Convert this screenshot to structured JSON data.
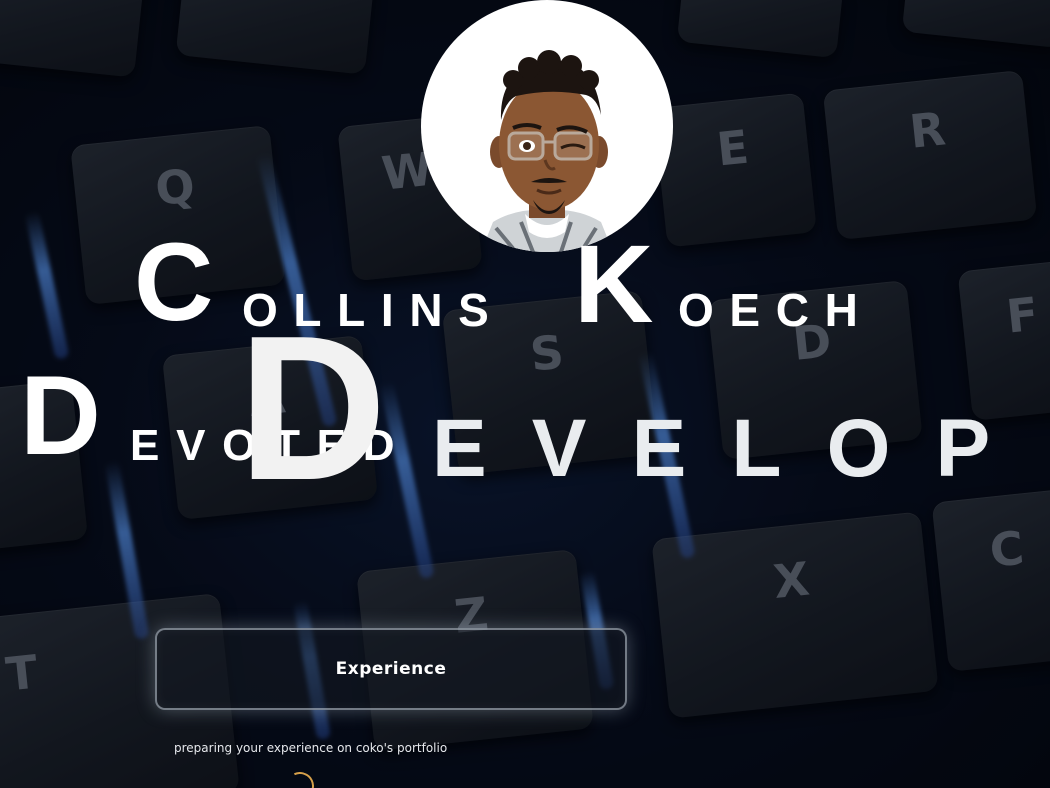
{
  "hero": {
    "first_name": {
      "initial": "C",
      "rest": "OLLINS"
    },
    "last_name": {
      "initial": "K",
      "rest": "OECH"
    },
    "tagline": {
      "word1_initial": "D",
      "word1_rest": "EVOTED",
      "word2_initial": "D",
      "word2_rest": "EVELOP"
    }
  },
  "avatar": {
    "icon": "memoji-avatar-icon"
  },
  "actions": {
    "experience_label": "Experience"
  },
  "status": {
    "loading_text": "preparing your experience on coko's portfolio",
    "spinner_icon": "loading-spinner-icon",
    "spinner_color": "#d6a04a"
  },
  "background": {
    "key_glyphs": [
      "Q",
      "W",
      "E",
      "R",
      "A",
      "S",
      "D",
      "F",
      "Z",
      "X",
      "C",
      "T"
    ],
    "glow_color": "#5fa0ff"
  }
}
